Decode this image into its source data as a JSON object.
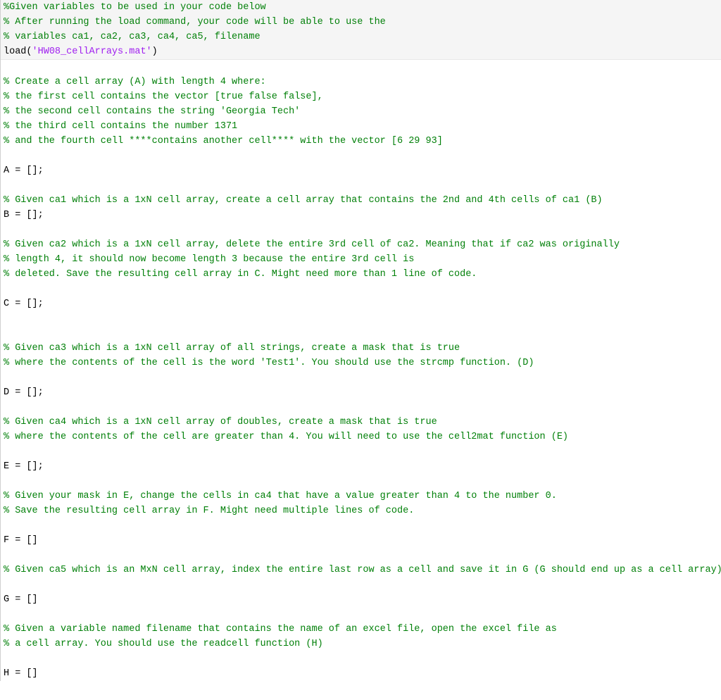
{
  "given": {
    "l1": "%Given variables to be used in your code below",
    "l2": "% After running the load command, your code will be able to use the",
    "l3": "% variables ca1, ca2, ca3, ca4, ca5, filename",
    "l4a": "load(",
    "l4b": "'HW08_cellArrays.mat'",
    "l4c": ")"
  },
  "body": {
    "blank1": "",
    "a1": "% Create a cell array (A) with length 4 where:",
    "a2": "% the first cell contains the vector [true false false],",
    "a3": "% the second cell contains the string 'Georgia Tech'",
    "a4": "% the third cell contains the number 1371",
    "a5": "% and the fourth cell ****contains another cell**** with the vector [6 29 93]",
    "blank2": "",
    "a_code": "A = [];",
    "blank3": "",
    "b1": "% Given ca1 which is a 1xN cell array, create a cell array that contains the 2nd and 4th cells of ca1 (B)",
    "b_code": "B = [];",
    "blank4": "",
    "c1": "% Given ca2 which is a 1xN cell array, delete the entire 3rd cell of ca2. Meaning that if ca2 was originally",
    "c2": "% length 4, it should now become length 3 because the entire 3rd cell is",
    "c3": "% deleted. Save the resulting cell array in C. Might need more than 1 line of code.",
    "blank5": "",
    "c_code": "C = [];",
    "blank6": "",
    "blank7": "",
    "d1": "% Given ca3 which is a 1xN cell array of all strings, create a mask that is true",
    "d2": "% where the contents of the cell is the word 'Test1'. You should use the strcmp function. (D)",
    "blank8": "",
    "d_code": "D = [];",
    "blank9": "",
    "e1": "% Given ca4 which is a 1xN cell array of doubles, create a mask that is true",
    "e2": "% where the contents of the cell are greater than 4. You will need to use the cell2mat function (E)",
    "blank10": "",
    "e_code": "E = [];",
    "blank11": "",
    "f1": "% Given your mask in E, change the cells in ca4 that have a value greater than 4 to the number 0.",
    "f2": "% Save the resulting cell array in F. Might need multiple lines of code.",
    "blank12": "",
    "f_code": "F = []",
    "blank13": "",
    "g1": "% Given ca5 which is an MxN cell array, index the entire last row as a cell and save it in G (G should end up as a cell array)",
    "blank14": "",
    "g_code": "G = []",
    "blank15": "",
    "h1": "% Given a variable named filename that contains the name of an excel file, open the excel file as",
    "h2": "% a cell array. You should use the readcell function (H)",
    "blank16": "",
    "h_code": "H = []"
  }
}
